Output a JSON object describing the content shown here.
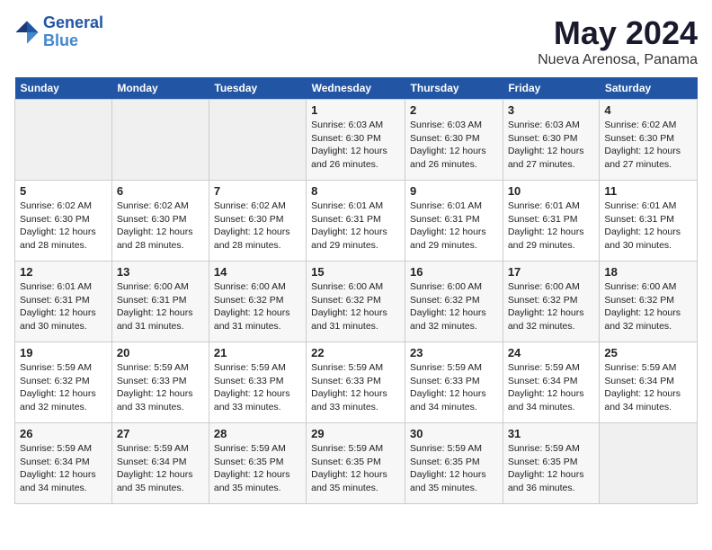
{
  "header": {
    "logo_line1": "General",
    "logo_line2": "Blue",
    "month": "May 2024",
    "location": "Nueva Arenosa, Panama"
  },
  "weekdays": [
    "Sunday",
    "Monday",
    "Tuesday",
    "Wednesday",
    "Thursday",
    "Friday",
    "Saturday"
  ],
  "weeks": [
    [
      {
        "day": "",
        "info": ""
      },
      {
        "day": "",
        "info": ""
      },
      {
        "day": "",
        "info": ""
      },
      {
        "day": "1",
        "info": "Sunrise: 6:03 AM\nSunset: 6:30 PM\nDaylight: 12 hours\nand 26 minutes."
      },
      {
        "day": "2",
        "info": "Sunrise: 6:03 AM\nSunset: 6:30 PM\nDaylight: 12 hours\nand 26 minutes."
      },
      {
        "day": "3",
        "info": "Sunrise: 6:03 AM\nSunset: 6:30 PM\nDaylight: 12 hours\nand 27 minutes."
      },
      {
        "day": "4",
        "info": "Sunrise: 6:02 AM\nSunset: 6:30 PM\nDaylight: 12 hours\nand 27 minutes."
      }
    ],
    [
      {
        "day": "5",
        "info": "Sunrise: 6:02 AM\nSunset: 6:30 PM\nDaylight: 12 hours\nand 28 minutes."
      },
      {
        "day": "6",
        "info": "Sunrise: 6:02 AM\nSunset: 6:30 PM\nDaylight: 12 hours\nand 28 minutes."
      },
      {
        "day": "7",
        "info": "Sunrise: 6:02 AM\nSunset: 6:30 PM\nDaylight: 12 hours\nand 28 minutes."
      },
      {
        "day": "8",
        "info": "Sunrise: 6:01 AM\nSunset: 6:31 PM\nDaylight: 12 hours\nand 29 minutes."
      },
      {
        "day": "9",
        "info": "Sunrise: 6:01 AM\nSunset: 6:31 PM\nDaylight: 12 hours\nand 29 minutes."
      },
      {
        "day": "10",
        "info": "Sunrise: 6:01 AM\nSunset: 6:31 PM\nDaylight: 12 hours\nand 29 minutes."
      },
      {
        "day": "11",
        "info": "Sunrise: 6:01 AM\nSunset: 6:31 PM\nDaylight: 12 hours\nand 30 minutes."
      }
    ],
    [
      {
        "day": "12",
        "info": "Sunrise: 6:01 AM\nSunset: 6:31 PM\nDaylight: 12 hours\nand 30 minutes."
      },
      {
        "day": "13",
        "info": "Sunrise: 6:00 AM\nSunset: 6:31 PM\nDaylight: 12 hours\nand 31 minutes."
      },
      {
        "day": "14",
        "info": "Sunrise: 6:00 AM\nSunset: 6:32 PM\nDaylight: 12 hours\nand 31 minutes."
      },
      {
        "day": "15",
        "info": "Sunrise: 6:00 AM\nSunset: 6:32 PM\nDaylight: 12 hours\nand 31 minutes."
      },
      {
        "day": "16",
        "info": "Sunrise: 6:00 AM\nSunset: 6:32 PM\nDaylight: 12 hours\nand 32 minutes."
      },
      {
        "day": "17",
        "info": "Sunrise: 6:00 AM\nSunset: 6:32 PM\nDaylight: 12 hours\nand 32 minutes."
      },
      {
        "day": "18",
        "info": "Sunrise: 6:00 AM\nSunset: 6:32 PM\nDaylight: 12 hours\nand 32 minutes."
      }
    ],
    [
      {
        "day": "19",
        "info": "Sunrise: 5:59 AM\nSunset: 6:32 PM\nDaylight: 12 hours\nand 32 minutes."
      },
      {
        "day": "20",
        "info": "Sunrise: 5:59 AM\nSunset: 6:33 PM\nDaylight: 12 hours\nand 33 minutes."
      },
      {
        "day": "21",
        "info": "Sunrise: 5:59 AM\nSunset: 6:33 PM\nDaylight: 12 hours\nand 33 minutes."
      },
      {
        "day": "22",
        "info": "Sunrise: 5:59 AM\nSunset: 6:33 PM\nDaylight: 12 hours\nand 33 minutes."
      },
      {
        "day": "23",
        "info": "Sunrise: 5:59 AM\nSunset: 6:33 PM\nDaylight: 12 hours\nand 34 minutes."
      },
      {
        "day": "24",
        "info": "Sunrise: 5:59 AM\nSunset: 6:34 PM\nDaylight: 12 hours\nand 34 minutes."
      },
      {
        "day": "25",
        "info": "Sunrise: 5:59 AM\nSunset: 6:34 PM\nDaylight: 12 hours\nand 34 minutes."
      }
    ],
    [
      {
        "day": "26",
        "info": "Sunrise: 5:59 AM\nSunset: 6:34 PM\nDaylight: 12 hours\nand 34 minutes."
      },
      {
        "day": "27",
        "info": "Sunrise: 5:59 AM\nSunset: 6:34 PM\nDaylight: 12 hours\nand 35 minutes."
      },
      {
        "day": "28",
        "info": "Sunrise: 5:59 AM\nSunset: 6:35 PM\nDaylight: 12 hours\nand 35 minutes."
      },
      {
        "day": "29",
        "info": "Sunrise: 5:59 AM\nSunset: 6:35 PM\nDaylight: 12 hours\nand 35 minutes."
      },
      {
        "day": "30",
        "info": "Sunrise: 5:59 AM\nSunset: 6:35 PM\nDaylight: 12 hours\nand 35 minutes."
      },
      {
        "day": "31",
        "info": "Sunrise: 5:59 AM\nSunset: 6:35 PM\nDaylight: 12 hours\nand 36 minutes."
      },
      {
        "day": "",
        "info": ""
      }
    ]
  ]
}
